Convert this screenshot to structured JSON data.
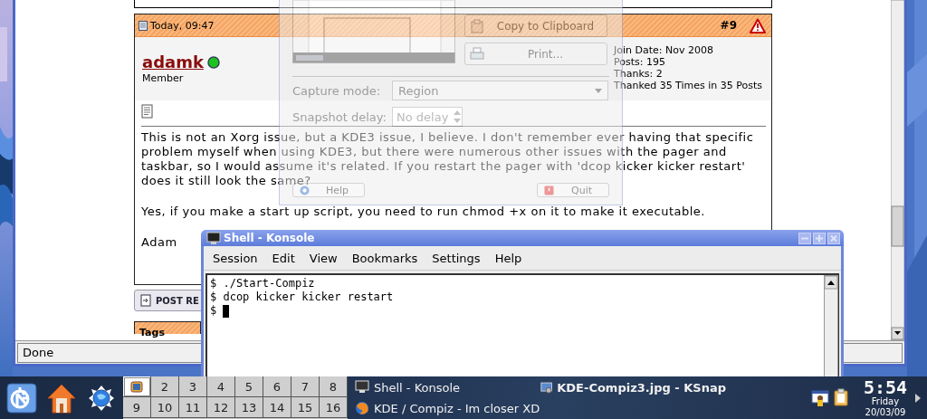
{
  "browser": {
    "post": {
      "date": "Today, 09:47",
      "number": "#9",
      "username": "adamk",
      "online": true,
      "user_title": "Member",
      "user_stats": [
        "Join Date: Nov 2008",
        "Posts: 195",
        "Thanks: 2",
        "Thanked 35 Times in 35 Posts"
      ],
      "paragraphs": [
        "This is not an Xorg issue, but a KDE3 issue, I believe. I don't remember ever having that specific problem myself when using KDE3, but there were numerous other issues with the pager and taskbar, so I would assume it's related. If you restart the pager with 'dcop kicker kicker restart' does it still look the same?",
        "Yes, if you make a start up script, you need to run chmod +x on it to make it executable.",
        "Adam"
      ]
    },
    "post_reply_button": "POST RE",
    "tags_label": "Tags",
    "status": "Done"
  },
  "snapshot_dialog": {
    "buttons": [
      {
        "label": "Copy to Clipboard",
        "kind": "copy"
      },
      {
        "label": "Print...",
        "kind": "print"
      }
    ],
    "capture_mode": {
      "label": "Capture mode:",
      "value": "Region"
    },
    "snapshot_delay": {
      "label": "Snapshot delay:",
      "value": "No delay"
    },
    "footer_buttons": [
      {
        "label": "Help",
        "kind": "help"
      },
      {
        "label": "Quit",
        "kind": "quit"
      }
    ]
  },
  "konsole": {
    "title": "Shell - Konsole",
    "menu": [
      "Session",
      "Edit",
      "View",
      "Bookmarks",
      "Settings",
      "Help"
    ],
    "lines": [
      "$ ./Start-Compiz",
      "$ dcop kicker kicker restart",
      "$"
    ]
  },
  "taskbar": {
    "launchers": [
      {
        "kind": "kmenu"
      },
      {
        "kind": "home"
      },
      {
        "kind": "browser"
      }
    ],
    "pager": [
      {
        "selected": true
      },
      {
        "label": "2",
        "selected": false
      },
      {
        "label": "3",
        "selected": false
      },
      {
        "label": "4",
        "selected": false
      },
      {
        "label": "5",
        "selected": false
      },
      {
        "label": "6",
        "selected": false
      },
      {
        "label": "7",
        "selected": false
      },
      {
        "label": "8",
        "selected": false
      },
      {
        "label": "9",
        "selected": false
      },
      {
        "label": "10",
        "selected": false
      },
      {
        "label": "11",
        "selected": false
      },
      {
        "label": "12",
        "selected": false
      },
      {
        "label": "13",
        "selected": false
      },
      {
        "label": "14",
        "selected": false
      },
      {
        "label": "15",
        "selected": false
      },
      {
        "label": "16",
        "selected": false
      }
    ],
    "tasks": [
      {
        "label": "Shell - Konsole",
        "kind": "terminal",
        "active": false
      },
      {
        "label": "KDE / Compiz - Im closer XD",
        "kind": "firefox",
        "active": false
      },
      {
        "label": "KDE-Compiz3.jpg - KSnap",
        "kind": "snapshot",
        "active": true
      }
    ],
    "tray": [
      {
        "kind": "calendar"
      },
      {
        "kind": "clipboard"
      }
    ],
    "clock": {
      "time": "5:54",
      "day": "Friday",
      "date": "20/03/09"
    }
  }
}
